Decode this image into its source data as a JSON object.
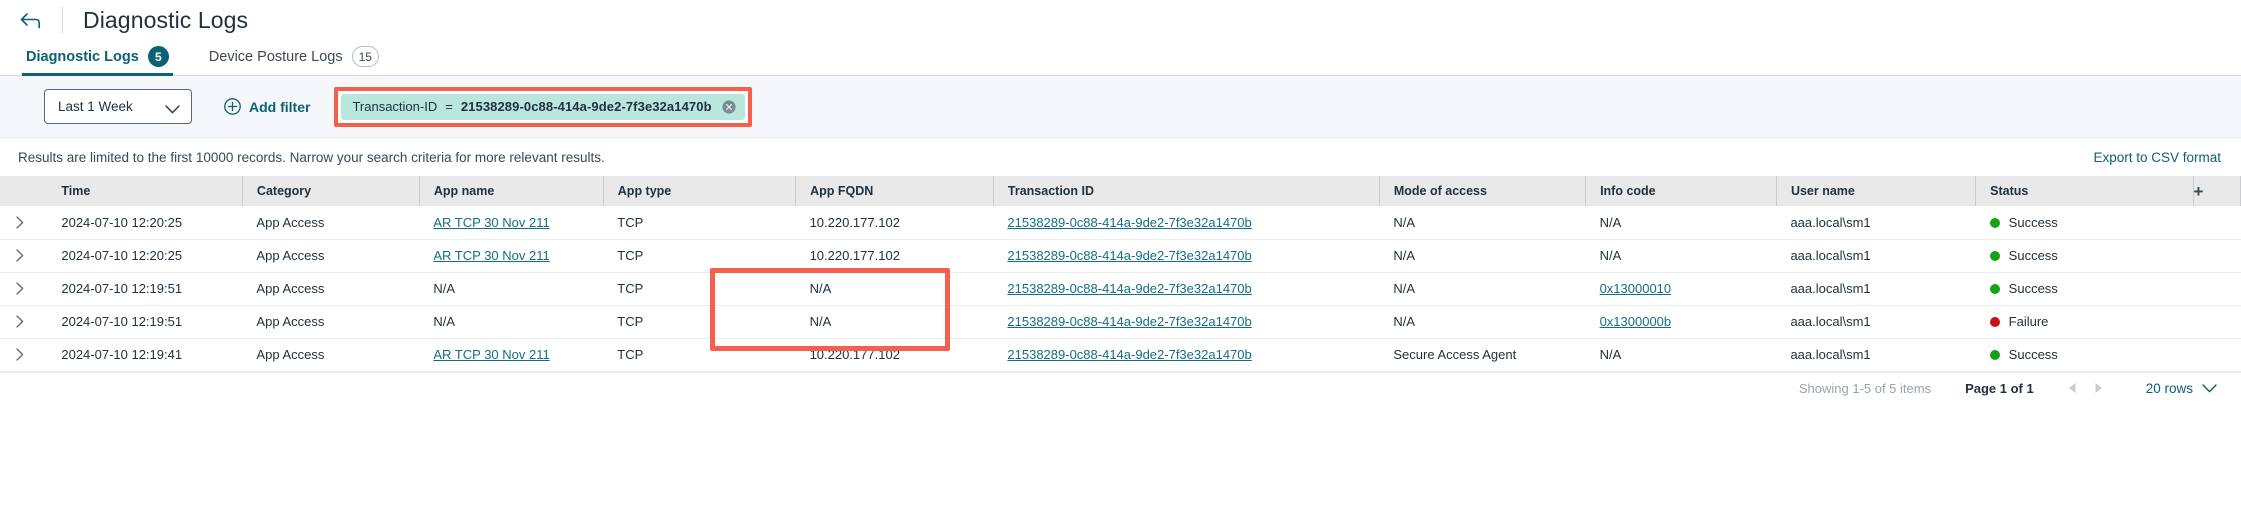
{
  "header": {
    "back_icon": "back-arrow-icon",
    "title": "Diagnostic Logs"
  },
  "tabs": [
    {
      "label": "Diagnostic Logs",
      "count": "5",
      "active": true
    },
    {
      "label": "Device Posture Logs",
      "count": "15",
      "active": false
    }
  ],
  "filterbar": {
    "time_range": "Last 1 Week",
    "add_filter_label": "Add filter",
    "chip": {
      "key": "Transaction-ID",
      "operator": "=",
      "value": "21538289-0c88-414a-9de2-7f3e32a1470b",
      "remove_icon": "clear-circle-icon"
    },
    "highlight_color": "#f4604d"
  },
  "notice": {
    "text": "Results are limited to the first 10000 records. Narrow your search criteria for more relevant results.",
    "export_label": "Export to CSV format"
  },
  "table": {
    "columns": [
      "Time",
      "Category",
      "App name",
      "App type",
      "App FQDN",
      "Transaction ID",
      "Mode of access",
      "Info code",
      "User name",
      "Status"
    ],
    "add_column_icon": "plus-icon",
    "rows": [
      {
        "time": "2024-07-10 12:20:25",
        "category": "App Access",
        "app_name": "AR TCP 30 Nov 211",
        "app_name_link": true,
        "app_type": "TCP",
        "app_fqdn": "10.220.177.102",
        "transaction_id": "21538289-0c88-414a-9de2-7f3e32a1470b",
        "mode_of_access": "N/A",
        "info_code": "N/A",
        "info_code_link": false,
        "user_name": "aaa.local\\sm1",
        "status": "Success",
        "status_color": "#18a118"
      },
      {
        "time": "2024-07-10 12:20:25",
        "category": "App Access",
        "app_name": "AR TCP 30 Nov 211",
        "app_name_link": true,
        "app_type": "TCP",
        "app_fqdn": "10.220.177.102",
        "transaction_id": "21538289-0c88-414a-9de2-7f3e32a1470b",
        "mode_of_access": "N/A",
        "info_code": "N/A",
        "info_code_link": false,
        "user_name": "aaa.local\\sm1",
        "status": "Success",
        "status_color": "#18a118"
      },
      {
        "time": "2024-07-10 12:19:51",
        "category": "App Access",
        "app_name": "N/A",
        "app_name_link": false,
        "app_type": "TCP",
        "app_fqdn": "N/A",
        "transaction_id": "21538289-0c88-414a-9de2-7f3e32a1470b",
        "mode_of_access": "N/A",
        "info_code": "0x13000010",
        "info_code_link": true,
        "user_name": "aaa.local\\sm1",
        "status": "Success",
        "status_color": "#18a118"
      },
      {
        "time": "2024-07-10 12:19:51",
        "category": "App Access",
        "app_name": "N/A",
        "app_name_link": false,
        "app_type": "TCP",
        "app_fqdn": "N/A",
        "transaction_id": "21538289-0c88-414a-9de2-7f3e32a1470b",
        "mode_of_access": "N/A",
        "info_code": "0x1300000b",
        "info_code_link": true,
        "user_name": "aaa.local\\sm1",
        "status": "Failure",
        "status_color": "#c4121a"
      },
      {
        "time": "2024-07-10 12:19:41",
        "category": "App Access",
        "app_name": "AR TCP 30 Nov 211",
        "app_name_link": true,
        "app_type": "TCP",
        "app_fqdn": "10.220.177.102",
        "transaction_id": "21538289-0c88-414a-9de2-7f3e32a1470b",
        "mode_of_access": "Secure Access Agent",
        "info_code": "N/A",
        "info_code_link": false,
        "user_name": "aaa.local\\sm1",
        "status": "Success",
        "status_color": "#18a118"
      }
    ]
  },
  "footer": {
    "showing": "Showing 1-5 of 5 items",
    "page": "Page 1 of 1",
    "prev_icon": "prev-page-icon",
    "next_icon": "next-page-icon",
    "rows_per_page": "20 rows"
  },
  "colors": {
    "accent": "#0c6174",
    "link": "#156d83",
    "highlight": "#f4604d",
    "chip_bg": "#b9e7de",
    "success": "#18a118",
    "failure": "#c4121a"
  }
}
